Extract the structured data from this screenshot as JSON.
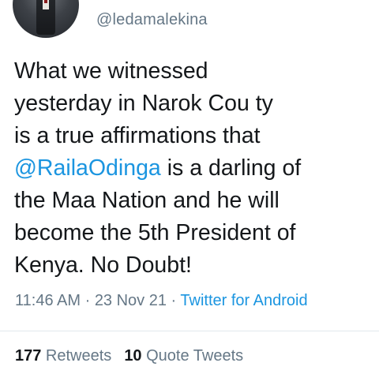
{
  "tweet": {
    "handle": "@ledamalekina",
    "text_lines": [
      "What we witnessed",
      "yesterday in Narok Cou ty",
      "is a true affirmations that",
      "@RailaOdinga",
      " is a darling of",
      "the Maa Nation and he will",
      "become the 5th President of",
      "Kenya. No Doubt!"
    ],
    "time": "11:46 AM",
    "separator": " · ",
    "date": "23 Nov 21",
    "source": "Twitter for Android",
    "retweets_count": "177",
    "retweets_label": " Retweets",
    "quote_count": "10",
    "quote_label": " Quote Tweets"
  },
  "colors": {
    "link": "#1b95e0",
    "secondary_text": "#657786",
    "primary_text": "#14171a",
    "divider": "#e1e8ed"
  },
  "icons": {
    "avatar": "profile-photo"
  }
}
